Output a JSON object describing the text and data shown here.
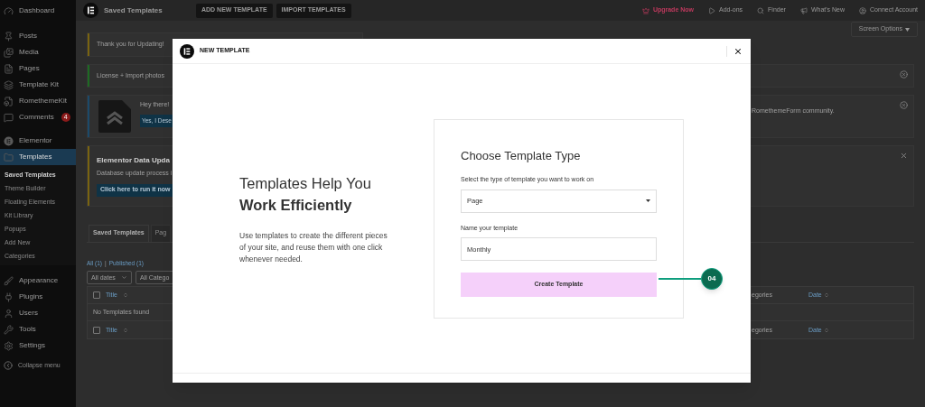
{
  "sidebar": {
    "sections": [
      {
        "items": [
          {
            "label": "Dashboard",
            "selected": false
          }
        ]
      },
      {
        "items": [
          {
            "label": "Posts",
            "selected": false
          },
          {
            "label": "Media",
            "selected": false
          },
          {
            "label": "Pages",
            "selected": false
          },
          {
            "label": "Template Kit",
            "selected": false
          },
          {
            "label": "RomethemeKit",
            "selected": false
          },
          {
            "label": "Comments",
            "selected": false,
            "badge": "4"
          }
        ]
      },
      {
        "items": [
          {
            "label": "Elementor",
            "selected": false
          },
          {
            "label": "Templates",
            "selected": true,
            "children": [
              {
                "label": "Saved Templates",
                "selected": true
              },
              {
                "label": "Theme Builder",
                "selected": false
              },
              {
                "label": "Floating Elements",
                "selected": false
              },
              {
                "label": "Kit Library",
                "selected": false
              },
              {
                "label": "Popups",
                "selected": false
              },
              {
                "label": "Add New",
                "selected": false
              },
              {
                "label": "Categories",
                "selected": false
              }
            ]
          }
        ]
      },
      {
        "items": [
          {
            "label": "Appearance",
            "selected": false
          },
          {
            "label": "Plugins",
            "selected": false
          },
          {
            "label": "Users",
            "selected": false
          },
          {
            "label": "Tools",
            "selected": false
          },
          {
            "label": "Settings",
            "selected": false
          }
        ]
      }
    ],
    "collapse": "Collapse menu"
  },
  "top_bar": {
    "title": "Saved Templates",
    "buttons": [
      "ADD NEW TEMPLATE",
      "IMPORT TEMPLATES"
    ],
    "links": [
      {
        "label": "Upgrade Now",
        "kind": "upgrade"
      },
      {
        "label": "Add-ons",
        "kind": "addons"
      },
      {
        "label": "Finder",
        "kind": "finder"
      },
      {
        "label": "What's New",
        "kind": "news"
      },
      {
        "label": "Connect Account",
        "kind": "account"
      }
    ]
  },
  "screen_options": "Screen Options",
  "notices": [
    {
      "color": "#7a6410",
      "text": "Thank you for Updating!"
    },
    {
      "color": "#1d6b22",
      "text": "License + Import photos"
    },
    {
      "color": "#1b4a6b",
      "text": "Hey there!",
      "button": "Yes, I Dese",
      "right_text": "RomethemeForm community."
    },
    {
      "color": "#7a6410",
      "title": "Elementor Data Upda",
      "text": "Database update process i",
      "button": "Click here to run it now"
    }
  ],
  "tabs": [
    {
      "label": "Saved Templates",
      "selected": true
    },
    {
      "label": "Pag",
      "selected": false
    }
  ],
  "views": [
    {
      "label": "All (1)"
    },
    {
      "label": "Published (1)"
    }
  ],
  "views_separator": "|",
  "filters": [
    "All dates",
    "All Catego"
  ],
  "table": {
    "header": {
      "checked": false,
      "columns": [
        "Title",
        "egories",
        "Date"
      ]
    },
    "empty": "No Templates found",
    "footer": {
      "checked": false,
      "columns": [
        "Title",
        "egories",
        "Date"
      ]
    }
  },
  "modal": {
    "title": "NEW TEMPLATE",
    "heading": "Templates Help You",
    "heading_bold": "Work Efficiently",
    "description": "Use templates to create the different pieces of your site, and reuse them with one click whenever needed.",
    "card_title": "Choose Template Type",
    "type_label": "Select the type of template you want to work on",
    "type_value": "Page",
    "name_label": "Name your template",
    "name_value": "Monthly",
    "submit": "Create Template"
  },
  "step_badge": "04"
}
